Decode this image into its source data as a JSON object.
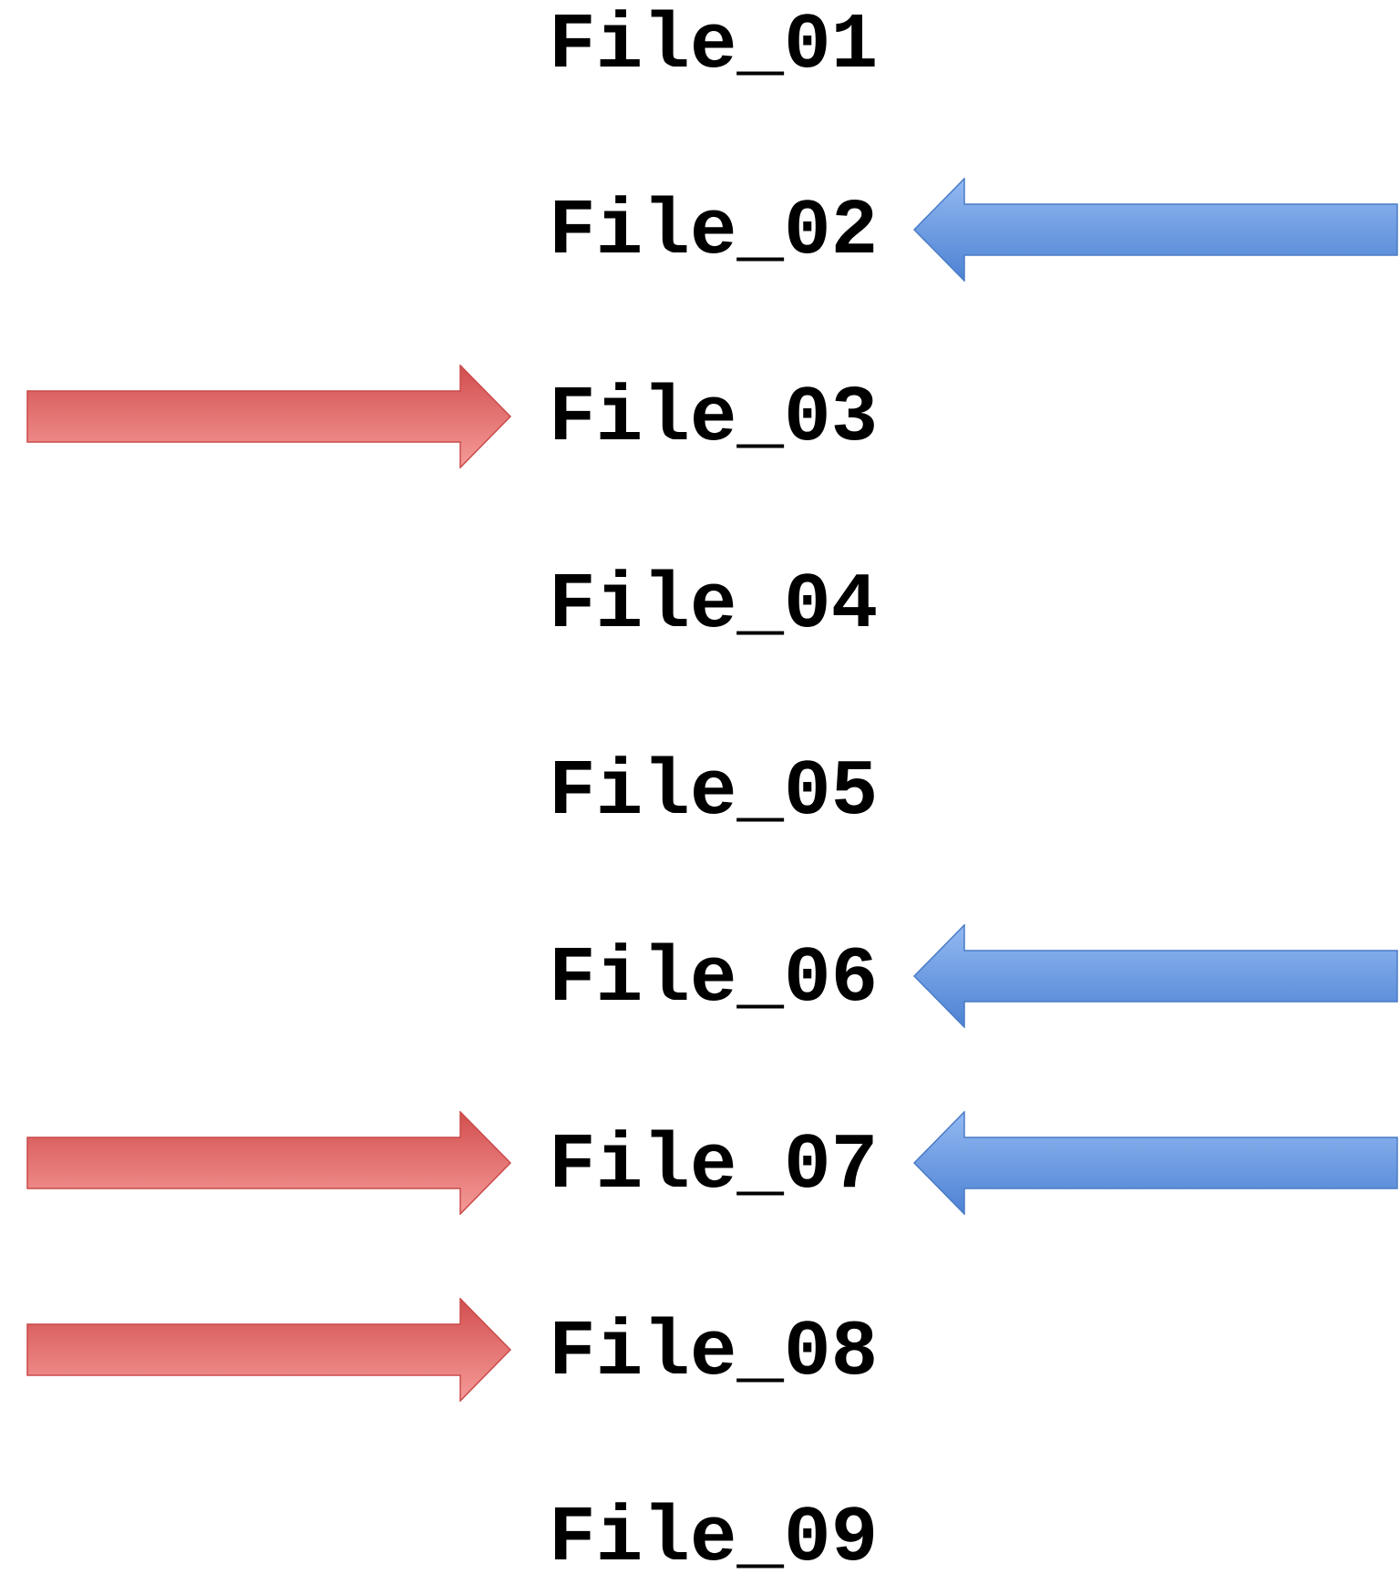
{
  "files": [
    {
      "label": "File_01",
      "in_arrow": false,
      "out_arrow": false
    },
    {
      "label": "File_02",
      "in_arrow": false,
      "out_arrow": true
    },
    {
      "label": "File_03",
      "in_arrow": true,
      "out_arrow": false
    },
    {
      "label": "File_04",
      "in_arrow": false,
      "out_arrow": false
    },
    {
      "label": "File_05",
      "in_arrow": false,
      "out_arrow": false
    },
    {
      "label": "File_06",
      "in_arrow": false,
      "out_arrow": true
    },
    {
      "label": "File_07",
      "in_arrow": true,
      "out_arrow": true
    },
    {
      "label": "File_08",
      "in_arrow": true,
      "out_arrow": false
    },
    {
      "label": "File_09",
      "in_arrow": false,
      "out_arrow": false
    }
  ],
  "colors": {
    "red_arrow_top": "#d24f4f",
    "red_arrow_bottom": "#f59b98",
    "red_arrow_stroke": "#c94a4a",
    "blue_arrow_top": "#93b9f2",
    "blue_arrow_bottom": "#4d82d3",
    "blue_arrow_stroke": "#4a7cc6"
  }
}
